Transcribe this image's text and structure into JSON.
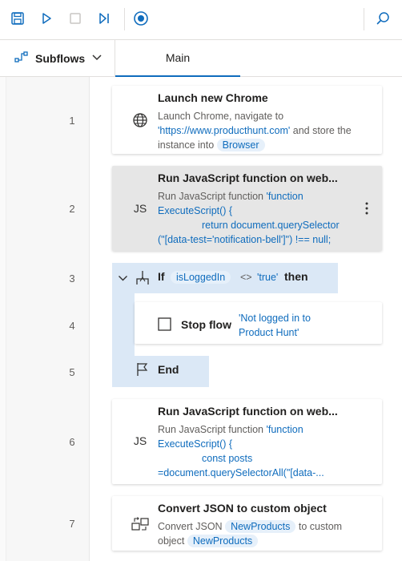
{
  "toolbar": {
    "buttons": [
      "save-icon",
      "run-icon",
      "stop-icon",
      "next-step-icon",
      "record-icon",
      "search-icon"
    ],
    "accent": "#0f6cbd"
  },
  "tabs": {
    "subflows_label": "Subflows",
    "main_label": "Main"
  },
  "actions": [
    {
      "line": "1",
      "title": "Launch new Chrome",
      "desc_text1": "Launch Chrome, navigate to ",
      "desc_str1": "'https://www.producthunt.com'",
      "desc_text2": " and store the instance into ",
      "desc_var1": "Browser"
    },
    {
      "line": "2",
      "icon_text": "JS",
      "title": "Run JavaScript function on web...",
      "desc_text1": "Run JavaScript function ",
      "desc_str1": "'function ExecuteScript() {",
      "desc_str2": "return document.querySelector",
      "desc_str3": "(\"[data-test='notification-bell']\") !== null;"
    },
    {
      "line": "3",
      "title": "If",
      "var1": "isLoggedIn",
      "operator": "<>",
      "str1": "'true'",
      "then": "then"
    },
    {
      "line": "4",
      "title": "Stop flow",
      "str1": "'Not logged in to",
      "str2": "Product Hunt'"
    },
    {
      "line": "5",
      "title": "End"
    },
    {
      "line": "6",
      "icon_text": "JS",
      "title": "Run JavaScript function on web...",
      "desc_text1": "Run JavaScript function ",
      "desc_str1": "'function ExecuteScript() {",
      "desc_str2": "const posts",
      "desc_str3": "=document.querySelectorAll(\"[data-..."
    },
    {
      "line": "7",
      "title": "Convert JSON to custom object",
      "desc_text1": "Convert JSON ",
      "desc_var1": "NewProducts",
      "desc_text2": " to custom object ",
      "desc_var2": "NewProducts"
    }
  ]
}
